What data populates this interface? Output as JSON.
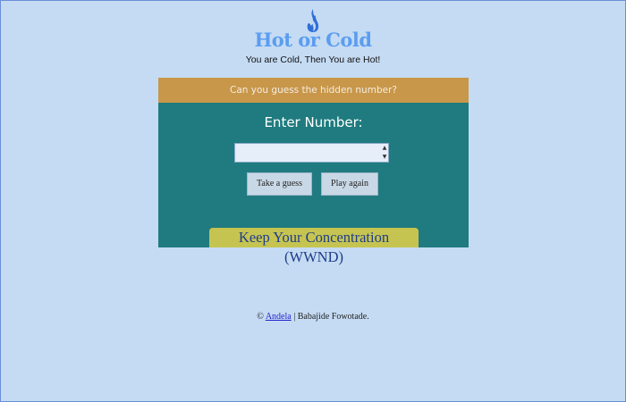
{
  "header": {
    "title": "Hot or Cold",
    "subtitle": "You are Cold, Then You are Hot!",
    "logo_icon": "flame-icon"
  },
  "game": {
    "prompt": "Can you guess the hidden number?",
    "enter_label": "Enter Number:",
    "input_value": "",
    "guess_button": "Take a guess",
    "again_button": "Play again",
    "message": "Keep Your Concentration (WWND)"
  },
  "footer": {
    "copyright": "©",
    "link_text": "Andela",
    "separator": "|",
    "author": "Babajide Fowotade."
  },
  "colors": {
    "background": "#c5dbf3",
    "title": "#5b9df0",
    "panel": "#1f7b7f",
    "header_bar": "#c8974a",
    "message_bg": "#c6c451",
    "message_text": "#1e3d8a"
  }
}
